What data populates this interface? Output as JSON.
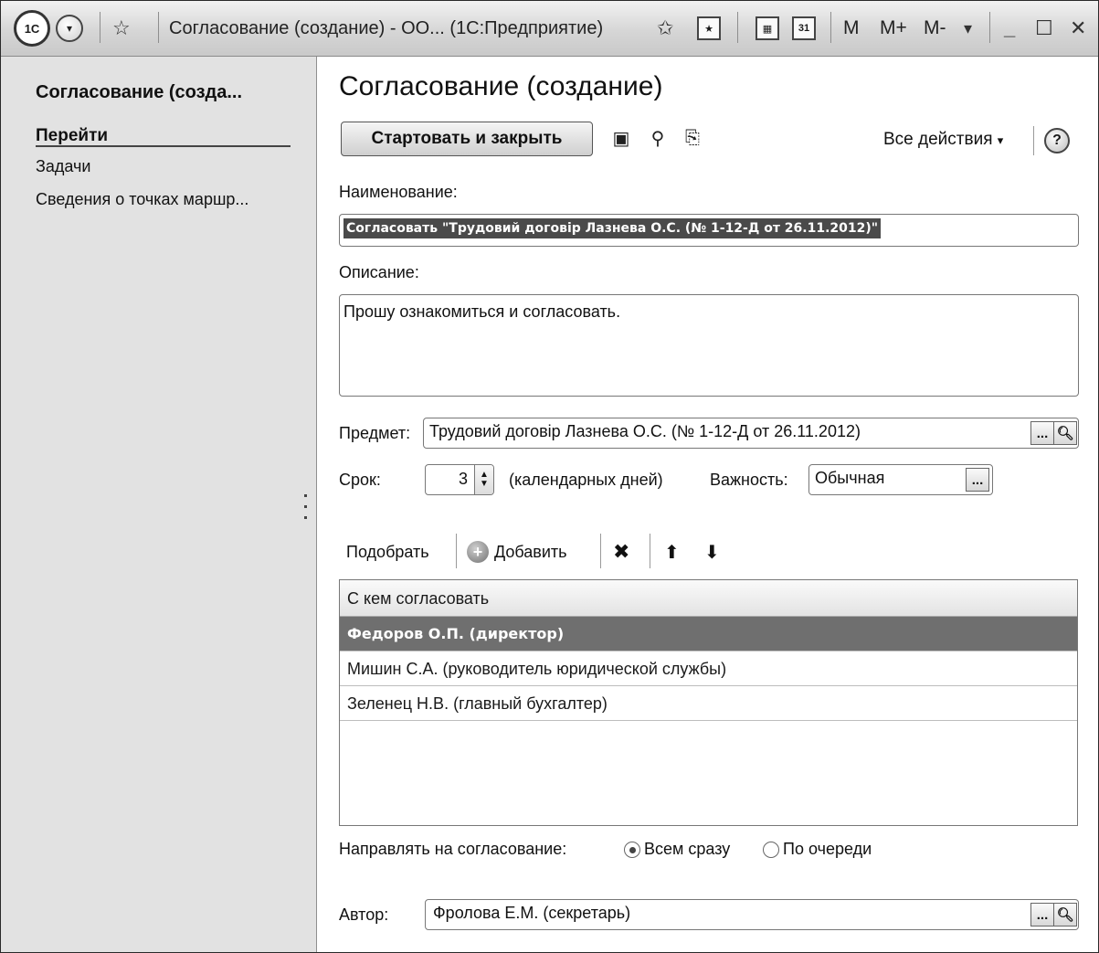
{
  "titlebar": {
    "logo_label": "1С",
    "title": "Согласование (создание) - ОО... (1С:Предприятие)",
    "calendar_day": "31",
    "m_label": "М",
    "m_plus_label": "М+",
    "m_minus_label": "М-"
  },
  "sidebar": {
    "title": "Согласование (созда...",
    "heading": "Перейти",
    "items": [
      {
        "label": "Задачи"
      },
      {
        "label": "Сведения о точках маршр..."
      }
    ]
  },
  "form": {
    "title": "Согласование (создание)",
    "start_close_label": "Стартовать и закрыть",
    "all_actions_label": "Все действия",
    "help_label": "?",
    "name_label": "Наименование:",
    "name_value": "Согласовать \"Трудовий договір Лазнева О.С. (№ 1-12-Д от 26.11.2012)\"",
    "description_label": "Описание:",
    "description_value": "Прошу ознакомиться и согласовать.",
    "subject_label": "Предмет:",
    "subject_value": "Трудовий договір Лазнева О.С. (№ 1-12-Д от 26.11.2012)",
    "term_label": "Срок:",
    "term_value": "3",
    "term_unit": "(календарных дней)",
    "importance_label": "Важность:",
    "importance_value": "Обычная",
    "ellipsis": "...",
    "author_label": "Автор:",
    "author_value": "Фролова Е.М. (секретарь)"
  },
  "toolbar": {
    "pick_label": "Подобрать",
    "add_label": "Добавить"
  },
  "approvers": {
    "column": "С кем согласовать",
    "rows": [
      {
        "name": "Федоров О.П. (директор)"
      },
      {
        "name": "Мишин С.А. (руководитель юридической службы)"
      },
      {
        "name": "Зеленец Н.В. (главный бухгалтер)"
      }
    ],
    "selected_index": 0
  },
  "routing": {
    "label": "Направлять на согласование:",
    "options": [
      "Всем сразу",
      "По очереди"
    ],
    "selected": "Всем сразу"
  }
}
